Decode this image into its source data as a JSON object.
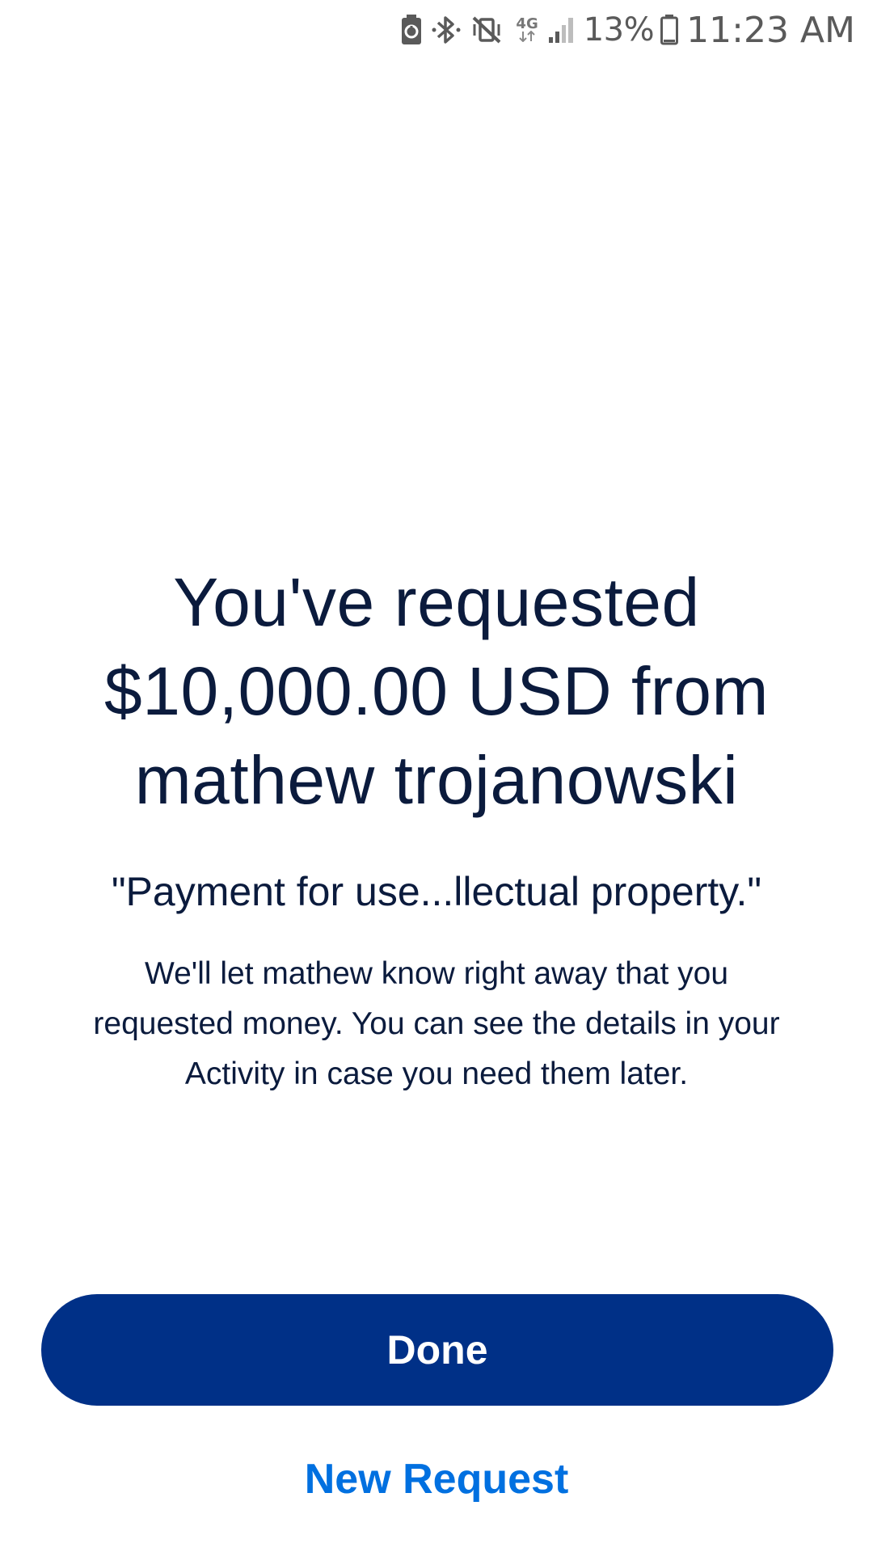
{
  "status_bar": {
    "network_type": "4G",
    "battery_percent": "13%",
    "time": "11:23 AM",
    "icons": [
      "battery-saver-icon",
      "bluetooth-icon",
      "vibrate-mute-icon",
      "network-4g-icon",
      "signal-icon",
      "battery-icon"
    ]
  },
  "confirmation": {
    "headline": "You've requested $10,000.00 USD from mathew  trojanowski",
    "note": "\"Payment for use...llectual property.\"",
    "info": "We'll let mathew know right away that you requested money. You can see the details in your Activity in case you need them later."
  },
  "actions": {
    "done_label": "Done",
    "new_request_label": "New Request"
  },
  "colors": {
    "primary_button": "#003087",
    "link": "#0070e0",
    "text": "#0b1b3d",
    "background": "#ffffff"
  }
}
